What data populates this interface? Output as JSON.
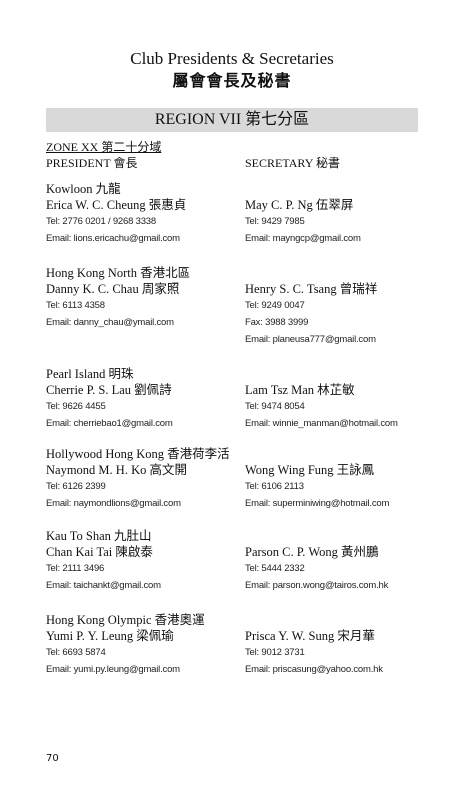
{
  "header": {
    "title_en": "Club Presidents & Secretaries",
    "title_zh": "屬會會長及秘書"
  },
  "region": {
    "label": "REGION VII  第七分區"
  },
  "zone": {
    "label": "ZONE XX  第二十分域"
  },
  "roles": {
    "president": "PRESIDENT  會長",
    "secretary": "SECRETARY  秘書"
  },
  "clubs": [
    {
      "name": "Kowloon  九龍",
      "president": {
        "name": "Erica W. C. Cheung  張惠貞",
        "lines": [
          "Tel: 2776 0201 / 9268 3338",
          "Email: lions.ericachu@gmail.com"
        ]
      },
      "secretary": {
        "name": "May C. P. Ng  伍翠屏",
        "lines": [
          "Tel: 9429 7985",
          "Email: mayngcp@gmail.com"
        ]
      }
    },
    {
      "name": "Hong Kong North  香港北區",
      "president": {
        "name": "Danny K. C. Chau  周家照",
        "lines": [
          "Tel: 6113 4358",
          "Email: danny_chau@ymail.com"
        ]
      },
      "secretary": {
        "name": "Henry S. C. Tsang  曾瑞祥",
        "lines": [
          "Tel: 9249 0047",
          "Fax: 3988 3999",
          "Email: planeusa777@gmail.com"
        ]
      }
    },
    {
      "name": "Pearl Island  明珠",
      "president": {
        "name": "Cherrie P. S. Lau  劉佩詩",
        "lines": [
          "Tel: 9626 4455",
          "Email: cherriebao1@gmail.com"
        ]
      },
      "secretary": {
        "name": "Lam Tsz Man  林芷敏",
        "lines": [
          "Tel: 9474 8054",
          "Email: winnie_manman@hotmail.com"
        ]
      }
    },
    {
      "name": "Hollywood Hong Kong  香港荷李活",
      "president": {
        "name": "Naymond M. H. Ko  高文開",
        "lines": [
          "Tel: 6126 2399",
          "Email: naymondlions@gmail.com"
        ]
      },
      "secretary": {
        "name": "Wong Wing Fung  王詠鳳",
        "lines": [
          "Tel: 6106 2113",
          "Email:  superminiwing@hotmail.com"
        ]
      }
    },
    {
      "name": "Kau To Shan  九肚山",
      "president": {
        "name": "Chan Kai Tai  陳啟泰",
        "lines": [
          "Tel: 2111 3496",
          "Email: taichankt@gmail.com"
        ]
      },
      "secretary": {
        "name": "Parson C. P. Wong  黃州鵬",
        "lines": [
          "Tel: 5444 2332",
          "Email: parson.wong@tairos.com.hk"
        ]
      }
    },
    {
      "name": "Hong Kong Olympic  香港奧運",
      "president": {
        "name": "Yumi P. Y. Leung  梁佩瑜",
        "lines": [
          "Tel: 6693 5874",
          "Email: yumi.py.leung@gmail.com"
        ]
      },
      "secretary": {
        "name": "Prisca Y. W. Sung 宋月華",
        "lines": [
          "Tel: 9012 3731",
          "Email: priscasung@yahoo.com.hk"
        ]
      }
    }
  ],
  "footer": {
    "page_number": "70"
  }
}
